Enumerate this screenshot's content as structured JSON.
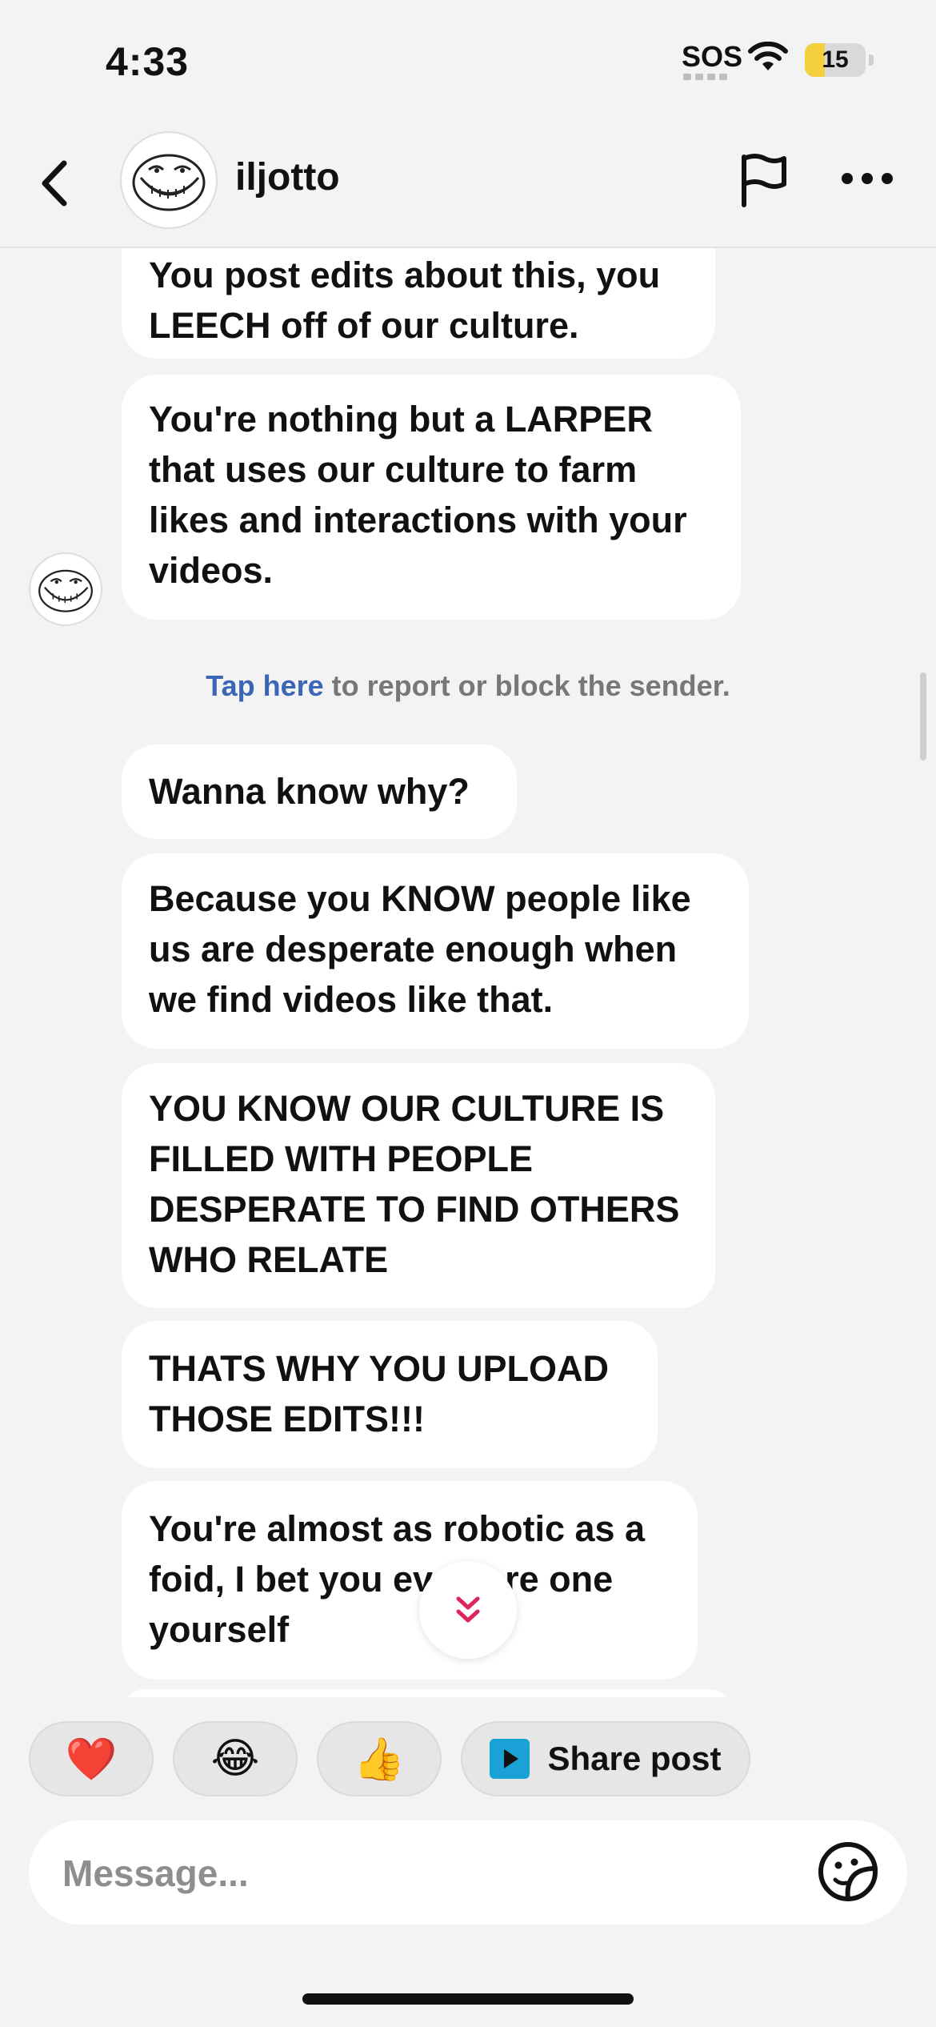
{
  "status_bar": {
    "time": "4:33",
    "sos": "SOS",
    "battery_percent": 15,
    "battery_label": "15"
  },
  "header": {
    "username": "iljotto",
    "back_icon": "chevron-left-icon",
    "flag_icon": "flag-icon",
    "more_icon": "more-horizontal-icon"
  },
  "messages": [
    "You post edits about this, you LEECH off of our culture.",
    "You're nothing but a LARPER that uses our culture to farm likes and interactions with your videos.",
    "Wanna know why?",
    "Because you KNOW people like us are desperate enough when we find videos like that.",
    "YOU KNOW OUR CULTURE IS FILLED WITH PEOPLE DESPERATE TO FIND OTHERS WHO RELATE",
    "THATS WHY YOU UPLOAD THOSE EDITS!!!",
    "You're almost as robotic as a foid, I bet you even are one yourself"
  ],
  "report_notice": {
    "link": "Tap here",
    "text": " to report or block the sender."
  },
  "quick_reactions": {
    "heart": "❤️",
    "laugh": "😂",
    "thumbs_up": "👍",
    "share_post": "Share post"
  },
  "composer": {
    "placeholder": "Message...",
    "value": ""
  },
  "colors": {
    "background": "#f3f3f3",
    "bubble": "#ffffff",
    "link": "#3b66b6",
    "scroll_arrow": "#e0245e",
    "battery": "#f4d03f"
  }
}
